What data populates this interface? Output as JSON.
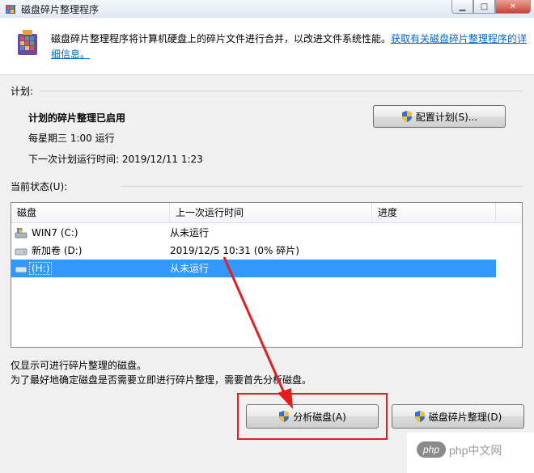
{
  "window": {
    "title": "磁盘碎片整理程序",
    "controls": {
      "minimize": "▁",
      "maximize": "□",
      "close": "✕"
    }
  },
  "header": {
    "description": "磁盘碎片整理程序将计算机硬盘上的碎片文件进行合并，以改进文件系统性能。",
    "link": "获取有关磁盘碎片整理程序的详细信息。"
  },
  "schedule": {
    "section_label": "计划:",
    "status": "计划的碎片整理已启用",
    "frequency": "每星期三  1:00 运行",
    "next_run": "下一次计划运行时间: 2019/12/11 1:23",
    "configure_button": "配置计划(S)..."
  },
  "current_status": {
    "section_label": "当前状态(U):",
    "columns": [
      "磁盘",
      "上一次运行时间",
      "进度"
    ],
    "rows": [
      {
        "disk": "WIN7 (C:)",
        "last_run": "从未运行",
        "progress": "",
        "icon": "system-drive-icon",
        "selected": false
      },
      {
        "disk": "新加卷 (D:)",
        "last_run": "2019/12/5 10:31 (0% 碎片)",
        "progress": "",
        "icon": "hard-drive-icon",
        "selected": false
      },
      {
        "disk": "(H:)",
        "last_run": "从未运行",
        "progress": "",
        "icon": "removable-drive-icon",
        "selected": true
      }
    ]
  },
  "info": {
    "line1": "仅显示可进行碎片整理的磁盘。",
    "line2": "为了最好地确定磁盘是否需要立即进行碎片整理，需要首先分析磁盘。"
  },
  "actions": {
    "analyze_button": "分析磁盘(A)",
    "defrag_button": "磁盘碎片整理(D)"
  },
  "watermark": {
    "text": "php中文网",
    "logo": "php"
  },
  "colors": {
    "selection": "#3399ff",
    "link": "#0066cc",
    "annotation": "#e02020"
  }
}
